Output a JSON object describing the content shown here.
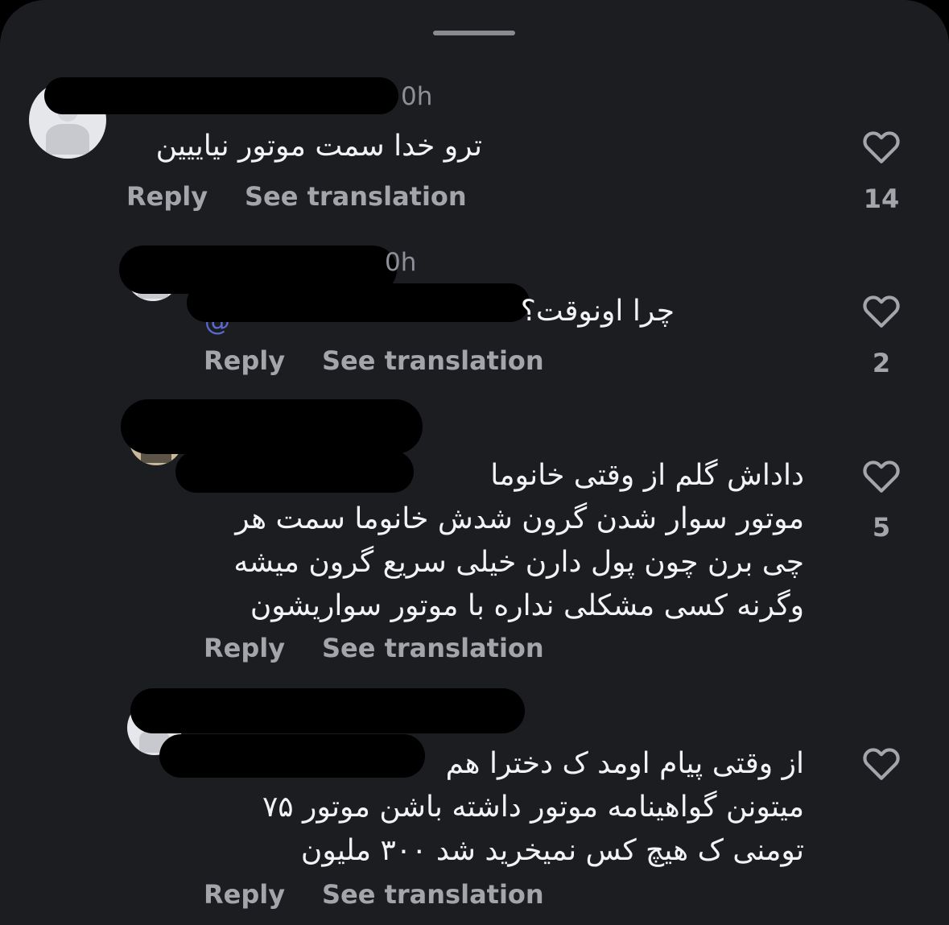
{
  "comments": [
    {
      "time": "0h",
      "text": "ترو خدا سمت موتور نیاییین",
      "reply_label": "Reply",
      "translate_label": "See translation",
      "likes": "14"
    },
    {
      "time": "0h",
      "mention": "@",
      "text": "چرا اونوقت؟",
      "reply_label": "Reply",
      "translate_label": "See translation",
      "likes": "2"
    },
    {
      "text": "داداش گلم از وقتی خانوما\nموتور سوار شدن گرون شدش خانوما سمت هر\nچی برن چون پول دارن خیلی سریع گرون میشه\nوگرنه کسی مشکلی نداره با موتور سواریشون",
      "reply_label": "Reply",
      "translate_label": "See translation",
      "likes": "5"
    },
    {
      "text": "از وقتی پیام اومد ک دخترا هم\nمیتونن گواهینامه موتور داشته باشن موتور ۷۵\nتومنی ک هیچ کس نمیخرید شد ۳۰۰ ملیون",
      "reply_label": "Reply",
      "translate_label": "See translation"
    }
  ],
  "icons": {
    "like": "heart-outline-icon",
    "avatar": "profile-avatar"
  },
  "colors": {
    "background": "#1c1d21",
    "text": "#f2f3f5",
    "muted": "#a3a5ab",
    "mention": "#5b6ad0"
  }
}
